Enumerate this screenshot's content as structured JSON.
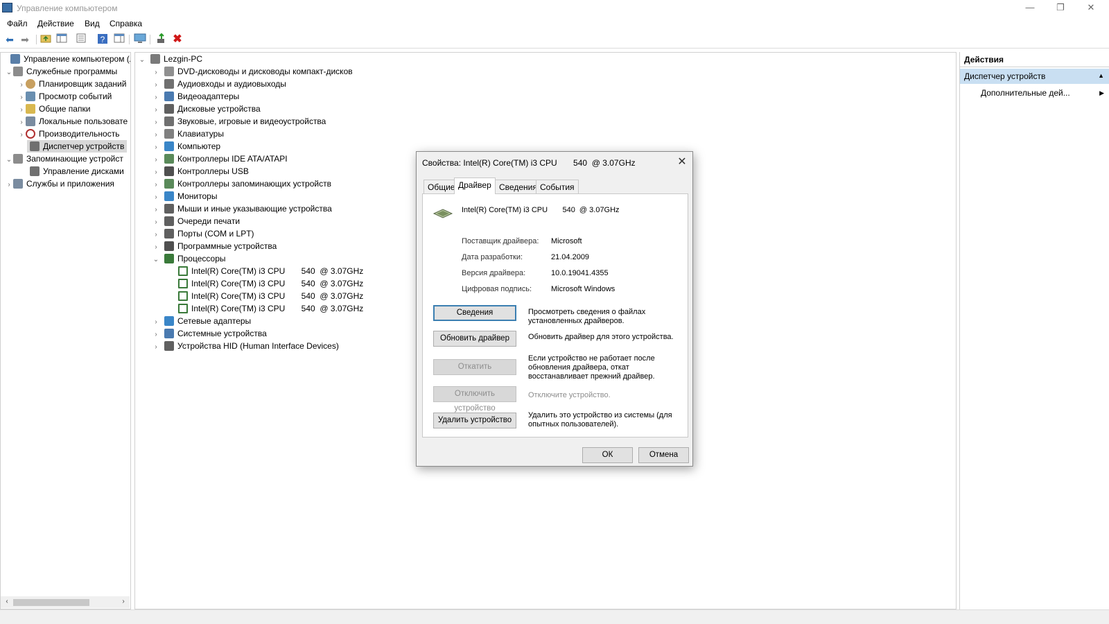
{
  "window": {
    "title": "Управление компьютером",
    "controls": {
      "minimize": "—",
      "maximize": "❐",
      "close": "✕"
    }
  },
  "menu": [
    "Файл",
    "Действие",
    "Вид",
    "Справка"
  ],
  "toolbar": {
    "icons": [
      "back-arrow-icon",
      "forward-arrow-icon",
      "folder-up-icon",
      "show-console-tree-icon",
      "properties-icon",
      "help-icon",
      "action-pane-icon",
      "monitor-icon",
      "update-driver-icon",
      "delete-icon"
    ]
  },
  "left_tree": {
    "items": [
      {
        "label": "Управление компьютером (л",
        "level": 0,
        "chevron": "",
        "icon": "computer-management-icon",
        "color": "#5a7fa8"
      },
      {
        "label": "Служебные программы",
        "level": 0,
        "chevron": "⌄",
        "icon": "tools-icon",
        "color": "#8c8c8c"
      },
      {
        "label": "Планировщик заданий",
        "level": 1,
        "chevron": "›",
        "icon": "clock-icon",
        "color": "#c8a060"
      },
      {
        "label": "Просмотр событий",
        "level": 1,
        "chevron": "›",
        "icon": "event-viewer-icon",
        "color": "#6a8fb0"
      },
      {
        "label": "Общие папки",
        "level": 1,
        "chevron": "›",
        "icon": "shared-folder-icon",
        "color": "#d8b850"
      },
      {
        "label": "Локальные пользовате",
        "level": 1,
        "chevron": "›",
        "icon": "users-icon",
        "color": "#7a8ca0"
      },
      {
        "label": "Производительность",
        "level": 1,
        "chevron": "›",
        "icon": "performance-icon",
        "color": "#b03030"
      },
      {
        "label": "Диспетчер устройств",
        "level": 1,
        "chevron": "",
        "icon": "device-manager-icon",
        "color": "#707070",
        "selected": true
      },
      {
        "label": "Запоминающие устройст",
        "level": 0,
        "chevron": "⌄",
        "icon": "storage-icon",
        "color": "#8c8c8c"
      },
      {
        "label": "Управление дисками",
        "level": 1,
        "chevron": "",
        "icon": "disk-management-icon",
        "color": "#707070"
      },
      {
        "label": "Службы и приложения",
        "level": 0,
        "chevron": "›",
        "icon": "services-icon",
        "color": "#7a8ca0"
      }
    ]
  },
  "device_tree": {
    "root": "Lezgin-PC",
    "items": [
      {
        "label": "DVD-дисководы и дисководы компакт-дисков",
        "icon": "dvd-drive-icon",
        "color": "#909090"
      },
      {
        "label": "Аудиовходы и аудиовыходы",
        "icon": "speaker-icon",
        "color": "#707070"
      },
      {
        "label": "Видеоадаптеры",
        "icon": "display-adapter-icon",
        "color": "#4a7ab0"
      },
      {
        "label": "Дисковые устройства",
        "icon": "disk-drive-icon",
        "color": "#606060"
      },
      {
        "label": "Звуковые, игровые и видеоустройства",
        "icon": "sound-icon",
        "color": "#707070"
      },
      {
        "label": "Клавиатуры",
        "icon": "keyboard-icon",
        "color": "#808080"
      },
      {
        "label": "Компьютер",
        "icon": "computer-icon",
        "color": "#3a86c8"
      },
      {
        "label": "Контроллеры IDE ATA/ATAPI",
        "icon": "ide-controller-icon",
        "color": "#5a8a5a"
      },
      {
        "label": "Контроллеры USB",
        "icon": "usb-icon",
        "color": "#505050"
      },
      {
        "label": "Контроллеры запоминающих устройств",
        "icon": "storage-controller-icon",
        "color": "#5a8a5a"
      },
      {
        "label": "Мониторы",
        "icon": "monitor-icon",
        "color": "#3a86c8"
      },
      {
        "label": "Мыши и иные указывающие устройства",
        "icon": "mouse-icon",
        "color": "#606060"
      },
      {
        "label": "Очереди печати",
        "icon": "printer-icon",
        "color": "#606060"
      },
      {
        "label": "Порты (COM и LPT)",
        "icon": "port-icon",
        "color": "#606060"
      },
      {
        "label": "Программные устройства",
        "icon": "software-device-icon",
        "color": "#505050"
      },
      {
        "label": "Процессоры",
        "icon": "processor-icon",
        "color": "#3a7a3a",
        "expanded": true,
        "children": [
          "Intel(R) Core(TM) i3 CPU       540  @ 3.07GHz",
          "Intel(R) Core(TM) i3 CPU       540  @ 3.07GHz",
          "Intel(R) Core(TM) i3 CPU       540  @ 3.07GHz",
          "Intel(R) Core(TM) i3 CPU       540  @ 3.07GHz"
        ]
      },
      {
        "label": "Сетевые адаптеры",
        "icon": "network-adapter-icon",
        "color": "#3a86c8"
      },
      {
        "label": "Системные устройства",
        "icon": "system-device-icon",
        "color": "#4a7ab0"
      },
      {
        "label": "Устройства HID (Human Interface Devices)",
        "icon": "hid-icon",
        "color": "#606060"
      }
    ]
  },
  "actions_pane": {
    "header": "Действия",
    "section": "Диспетчер устройств",
    "more": "Дополнительные дей..."
  },
  "dialog": {
    "title": "Свойства: Intel(R) Core(TM) i3 CPU       540  @ 3.07GHz",
    "tabs": [
      "Общие",
      "Драйвер",
      "Сведения",
      "События"
    ],
    "active_tab": "Драйвер",
    "device_name": "Intel(R) Core(TM) i3 CPU       540  @ 3.07GHz",
    "props": [
      {
        "label": "Поставщик драйвера:",
        "value": "Microsoft"
      },
      {
        "label": "Дата разработки:",
        "value": "21.04.2009"
      },
      {
        "label": "Версия драйвера:",
        "value": "10.0.19041.4355"
      },
      {
        "label": "Цифровая подпись:",
        "value": "Microsoft Windows"
      }
    ],
    "actions": [
      {
        "button": "Сведения",
        "desc": "Просмотреть сведения о файлах установленных драйверов.",
        "enabled": true
      },
      {
        "button": "Обновить драйвер",
        "desc": "Обновить драйвер для этого устройства.",
        "enabled": true
      },
      {
        "button": "Откатить",
        "desc": "Если устройство не работает после обновления драйвера, откат восстанавливает прежний драйвер.",
        "enabled": false
      },
      {
        "button": "Отключить устройство",
        "desc": "Отключите устройство.",
        "enabled": false
      },
      {
        "button": "Удалить устройство",
        "desc": "Удалить это устройство из системы (для опытных пользователей).",
        "enabled": true
      }
    ],
    "ok": "ОК",
    "cancel": "Отмена"
  }
}
